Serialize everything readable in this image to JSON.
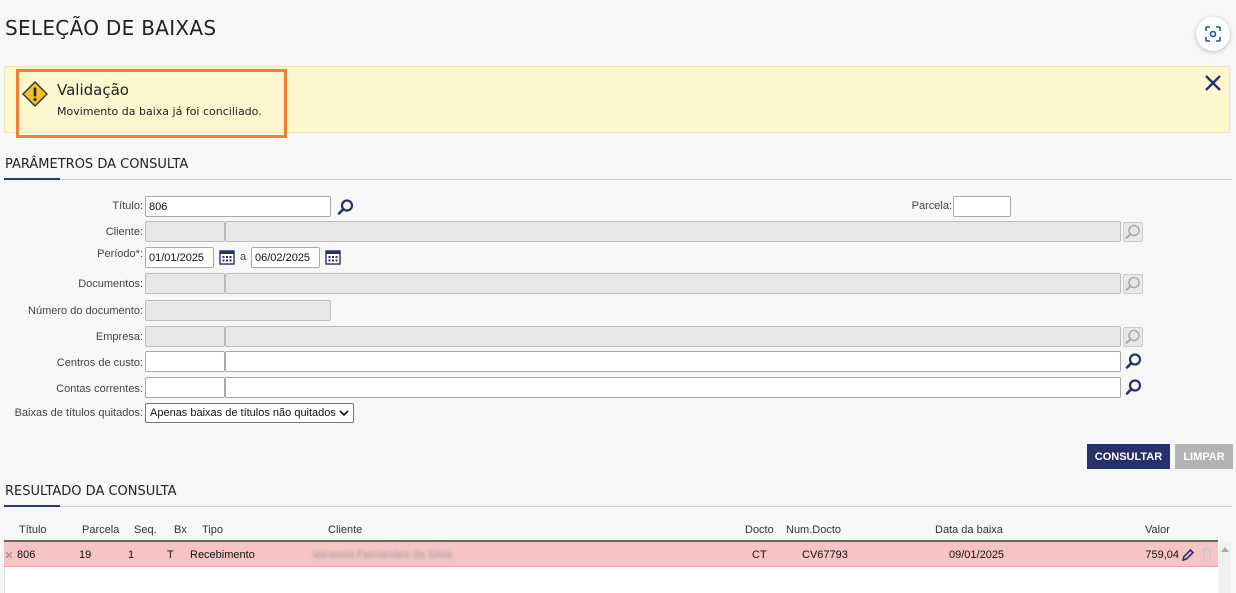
{
  "page_title": "SELEÇÃO DE BAIXAS",
  "alert": {
    "title": "Validação",
    "message": "Movimento da baixa já foi conciliado."
  },
  "params": {
    "section_title": "PARÂMETROS DA CONSULTA",
    "titulo_label": "Título:",
    "titulo_value": "806",
    "parcela_label": "Parcela:",
    "parcela_value": "",
    "cliente_label": "Cliente:",
    "periodo_label": "Período*:",
    "periodo_from": "01/01/2025",
    "periodo_sep": "a",
    "periodo_to": "06/02/2025",
    "documentos_label": "Documentos:",
    "numero_doc_label": "Número do documento:",
    "empresa_label": "Empresa:",
    "centros_label": "Centros de custo:",
    "contas_label": "Contas correntes:",
    "baixas_label": "Baixas de títulos quitados:",
    "baixas_selected": "Apenas baixas de títulos não quitados"
  },
  "buttons": {
    "consultar": "CONSULTAR",
    "limpar": "LIMPAR"
  },
  "results": {
    "section_title": "RESULTADO DA CONSULTA",
    "columns": [
      "Título",
      "Parcela",
      "Seq.",
      "Bx",
      "Tipo",
      "Cliente",
      "Docto",
      "Num.Docto",
      "Data da baixa",
      "Valor"
    ],
    "rows": [
      {
        "titulo": "806",
        "parcela": "19",
        "seq": "1",
        "bx": "T",
        "tipo": "Recebimento",
        "cliente": "Vanessa Fernandes da Silva",
        "docto": "CT",
        "num_docto": "CV67793",
        "data_baixa": "09/01/2025",
        "valor": "759,04"
      }
    ]
  },
  "colors": {
    "primary": "#27306a",
    "alert_bg": "#fcf7cf",
    "highlight": "#f08030",
    "row_error": "#f7c4c4"
  }
}
